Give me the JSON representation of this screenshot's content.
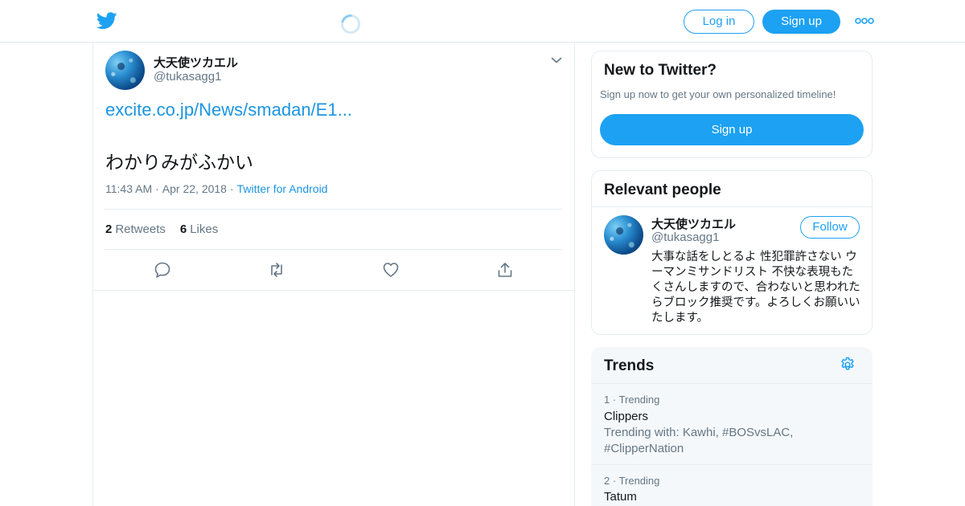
{
  "header": {
    "login_label": "Log in",
    "signup_label": "Sign up",
    "brand_color": "#1da1f2"
  },
  "tweet": {
    "display_name": "大天使ツカエル",
    "handle": "@tukasagg1",
    "link_text": "excite.co.jp/News/smadan/E1...",
    "text": "わかりみがふかい",
    "time": "11:43 AM",
    "date": "Apr 22, 2018",
    "source": "Twitter for Android",
    "retweets_count": "2",
    "retweets_label": "Retweets",
    "likes_count": "6",
    "likes_label": "Likes"
  },
  "signup_card": {
    "title": "New to Twitter?",
    "subtitle": "Sign up now to get your own personalized timeline!",
    "button_label": "Sign up"
  },
  "relevant_people": {
    "title": "Relevant people",
    "person": {
      "display_name": "大天使ツカエル",
      "handle": "@tukasagg1",
      "follow_label": "Follow",
      "bio": "大事な話をしとるよ 性犯罪許さない ウーマンミサンドリスト 不快な表現もたくさんしますので、合わないと思われたらブロック推奨です。よろしくお願いいたします。"
    }
  },
  "trends": {
    "title": "Trends",
    "items": [
      {
        "rank": "1",
        "label": "Trending",
        "name": "Clippers",
        "with": "Trending with: Kawhi, #BOSvsLAC, #ClipperNation"
      },
      {
        "rank": "2",
        "label": "Trending",
        "name": "Tatum"
      }
    ]
  }
}
